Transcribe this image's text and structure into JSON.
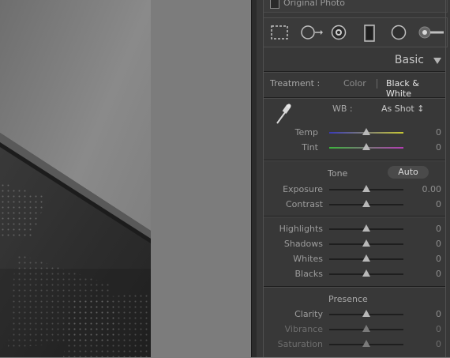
{
  "filmstrip_photo": {
    "alt": ""
  },
  "original_photo": {
    "label": "Original Photo"
  },
  "tools": [
    {
      "icon": "crop-overlay-icon"
    },
    {
      "icon": "spot-removal-icon"
    },
    {
      "icon": "red-eye-icon"
    },
    {
      "icon": "graduated-filter-icon"
    },
    {
      "icon": "radial-filter-icon"
    },
    {
      "icon": "adjustment-brush-icon"
    }
  ],
  "panel": {
    "title": "Basic",
    "treatment": {
      "label": "Treatment :",
      "color": "Color",
      "bw": "Black & White",
      "selected": "Black & White"
    },
    "wb": {
      "label": "WB :",
      "value": "As Shot ↕"
    },
    "temp": {
      "label": "Temp",
      "value": "0",
      "level": 0.5
    },
    "tint": {
      "label": "Tint",
      "value": "0",
      "level": 0.5
    },
    "tone": {
      "label": "Tone",
      "auto": "Auto"
    },
    "exposure": {
      "label": "Exposure",
      "value": "0.00",
      "level": 0.5
    },
    "contrast": {
      "label": "Contrast",
      "value": "0",
      "level": 0.5
    },
    "highlights": {
      "label": "Highlights",
      "value": "0",
      "level": 0.5
    },
    "shadows": {
      "label": "Shadows",
      "value": "0",
      "level": 0.5
    },
    "whites": {
      "label": "Whites",
      "value": "0",
      "level": 0.5
    },
    "blacks": {
      "label": "Blacks",
      "value": "0",
      "level": 0.5
    },
    "presence": {
      "label": "Presence"
    },
    "clarity": {
      "label": "Clarity",
      "value": "0",
      "level": 0.5
    },
    "vibrance": {
      "label": "Vibrance",
      "value": "0",
      "level": 0.5
    },
    "saturation": {
      "label": "Saturation",
      "value": "0",
      "level": 0.5
    }
  },
  "colors": {
    "temp_gradient": [
      "#3a3ab8",
      "#c8c832"
    ],
    "tint_gradient": [
      "#3cb43c",
      "#b43cb4"
    ],
    "neutral_track": "#1e1e1e"
  }
}
